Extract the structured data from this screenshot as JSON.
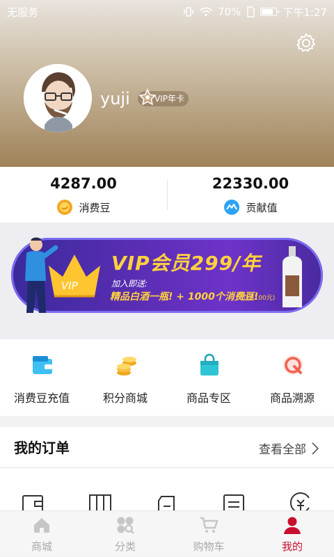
{
  "status_bar": {
    "carrier": "无服务",
    "battery": "70%",
    "time": "下午1:27",
    "battery_level": 0.7
  },
  "profile": {
    "username": "yuji",
    "badge": "VIP年卡"
  },
  "stats": [
    {
      "value": "4287.00",
      "label": "消费豆",
      "icon": "bean-coin-icon",
      "color": "#f5a623"
    },
    {
      "value": "22330.00",
      "label": "贡献值",
      "icon": "contribution-icon",
      "color": "#2ea3f2"
    }
  ],
  "banner": {
    "title": "VIP会员299/年",
    "crown_text": "VIP",
    "line1": "加入即送:",
    "line2": "精品白酒一瓶! + 1000个消费豆!",
    "line3": "(价值100元)"
  },
  "menu": [
    {
      "label": "消费豆充值",
      "icon": "wallet-recharge-icon"
    },
    {
      "label": "积分商城",
      "icon": "coins-stack-icon"
    },
    {
      "label": "商品专区",
      "icon": "shopping-bag-icon"
    },
    {
      "label": "商品溯源",
      "icon": "trace-source-icon"
    }
  ],
  "orders": {
    "title": "我的订单",
    "view_all": "查看全部"
  },
  "order_icons": [
    "pending-payment-icon",
    "pending-shipment-icon",
    "pending-receipt-icon",
    "pending-review-icon",
    "refund-icon"
  ],
  "tabs": [
    {
      "label": "商城",
      "icon": "home-icon",
      "active": false
    },
    {
      "label": "分类",
      "icon": "category-icon",
      "active": false
    },
    {
      "label": "购物车",
      "icon": "cart-icon",
      "active": false
    },
    {
      "label": "我的",
      "icon": "user-icon",
      "active": true
    }
  ],
  "colors": {
    "accent": "#c8102e",
    "gold": "#ffd23c",
    "banner_purple": "#5a2db3"
  }
}
